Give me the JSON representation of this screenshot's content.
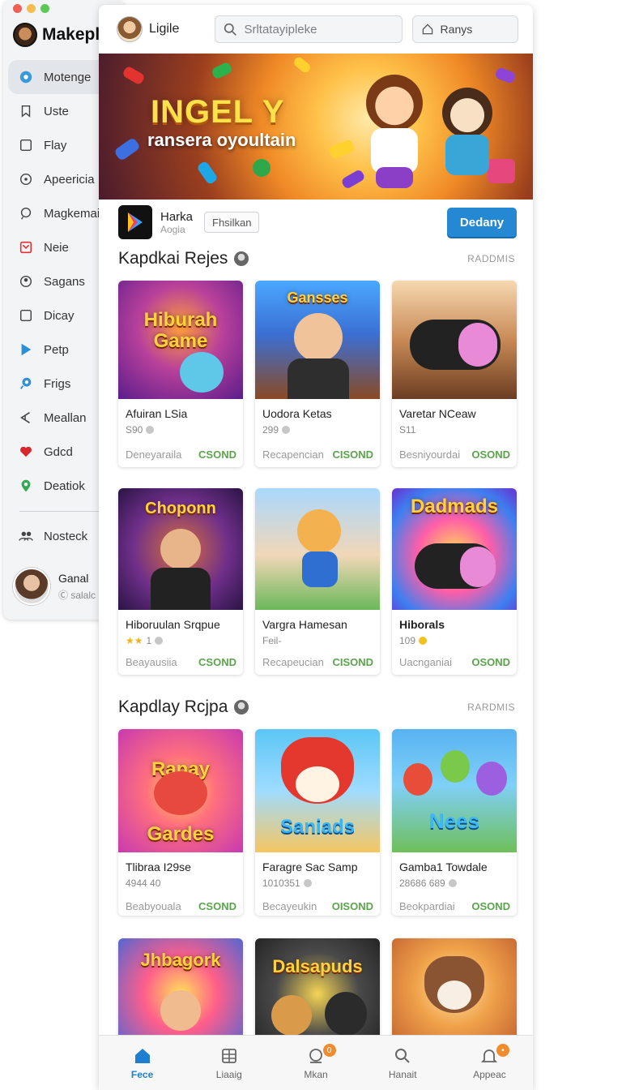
{
  "sidebar": {
    "brand": "Makeplo",
    "items": [
      {
        "label": "Motenge",
        "icon": "compass-icon",
        "active": true
      },
      {
        "label": "Uste",
        "icon": "bookmark-icon"
      },
      {
        "label": "Flay",
        "icon": "square-icon"
      },
      {
        "label": "Apeericia",
        "icon": "chat-icon"
      },
      {
        "label": "Magkemainv",
        "icon": "location-icon"
      },
      {
        "label": "Neie",
        "icon": "checkbox-icon"
      },
      {
        "label": "Sagans",
        "icon": "user-icon"
      },
      {
        "label": "Dicay",
        "icon": "square-icon"
      },
      {
        "label": "Petp",
        "icon": "play-icon"
      },
      {
        "label": "Frigs",
        "icon": "pin-icon"
      },
      {
        "label": "Meallan",
        "icon": "share-icon"
      },
      {
        "label": "Gdcd",
        "icon": "heart-icon"
      },
      {
        "label": "Deatiok",
        "icon": "map-pin-icon"
      }
    ],
    "bottom_item": {
      "label": "Nosteck",
      "icon": "users-icon"
    },
    "user": {
      "name": "Ganal",
      "sub": "salalc"
    }
  },
  "topbar": {
    "profile_name": "Ligile",
    "search_placeholder": "Srltatayipleke",
    "rank_label": "Ranys"
  },
  "hero": {
    "title": "INGEL Y",
    "subtitle": "ransera oyoultain"
  },
  "featured_app": {
    "name": "Harka",
    "sub": "Aogia",
    "tag": "Fhsilkan",
    "button": "Dedany"
  },
  "sections": [
    {
      "title": "Kapdkai Rejes",
      "more": "RADDMIS",
      "cards": [
        {
          "title": "Afuiran LSia",
          "rating": "S90",
          "dev": "Deneyaraila",
          "action": "CSOND",
          "art": "Hiburah Game"
        },
        {
          "title": "Uodora Ketas",
          "rating": "299",
          "dev": "Recapencian",
          "action": "CISOND",
          "art": "Gansses"
        },
        {
          "title": "Varetar NCeaw",
          "rating": "S11",
          "dev": "Besniyourdai",
          "action": "OSOND",
          "art": ""
        },
        {
          "title": "Hiboruulan Srqpue",
          "rating": "1",
          "dev": "Beayausiia",
          "action": "CSOND",
          "art": "Choponn"
        },
        {
          "title": "Vargra Hamesan",
          "rating": "Feil-",
          "dev": "Recapeucian",
          "action": "CISOND",
          "art": ""
        },
        {
          "title": "Hiborals",
          "rating": "109",
          "dev": "Uacnganiai",
          "action": "OSOND",
          "art": "Dadmads"
        }
      ]
    },
    {
      "title": "Kapdlay Rcjpa",
      "more": "RARDMIS",
      "cards": [
        {
          "title": "Tlibraa I29se",
          "rating": "4944 40",
          "dev": "Beabyouala",
          "action": "CSOND",
          "art": "Ranay Gardes"
        },
        {
          "title": "Faragre Sac Samp",
          "rating": "1010351",
          "dev": "Becayeukin",
          "action": "OISOND",
          "art": "Saniads"
        },
        {
          "title": "Gamba1 Towdale",
          "rating": "28686 689",
          "dev": "Beokpardiai",
          "action": "OSOND",
          "art": "Nees"
        },
        {
          "title": "",
          "rating": "",
          "dev": "",
          "action": "",
          "art": "Jhbagork"
        },
        {
          "title": "",
          "rating": "",
          "dev": "",
          "action": "",
          "art": "Dalsapuds"
        },
        {
          "title": "",
          "rating": "",
          "dev": "",
          "action": "",
          "art": ""
        }
      ]
    }
  ],
  "bottom_nav": [
    {
      "label": "Fece",
      "icon": "home-icon",
      "active": true
    },
    {
      "label": "Liaaig",
      "icon": "grid-icon"
    },
    {
      "label": "Mkan",
      "icon": "chat-bubble-icon",
      "badge": "0"
    },
    {
      "label": "Hanait",
      "icon": "search-icon"
    },
    {
      "label": "Appeac",
      "icon": "bell-icon",
      "badge": ""
    }
  ],
  "colors": {
    "accent": "#2489d2",
    "action_green": "#5aa54c",
    "active_tab": "#1e7fd0",
    "badge_orange": "#f08c2e"
  }
}
